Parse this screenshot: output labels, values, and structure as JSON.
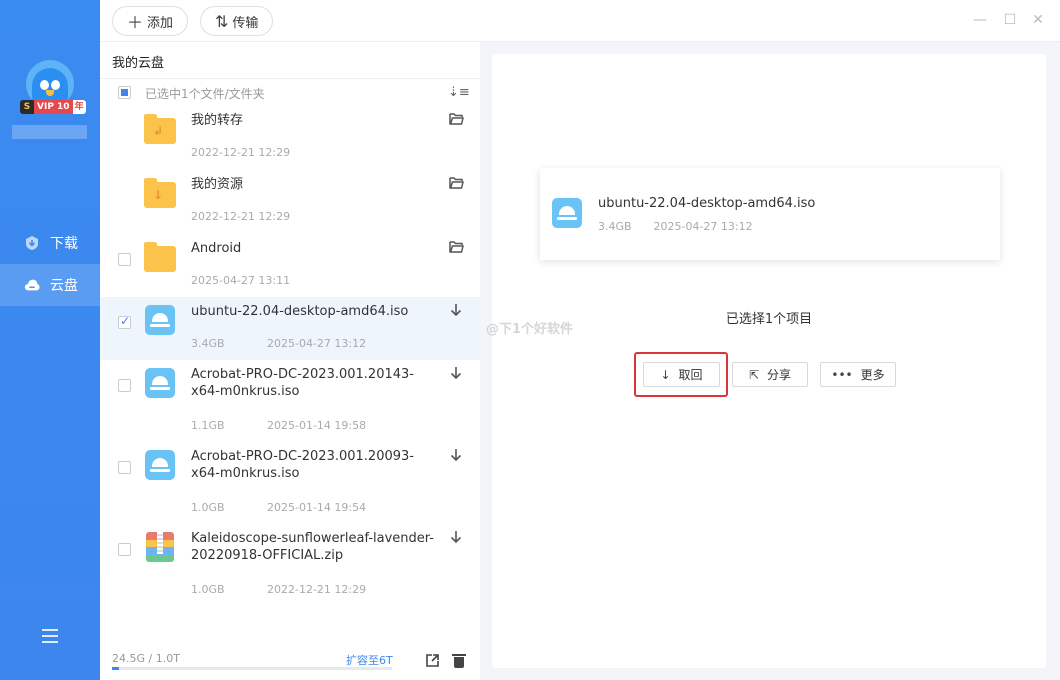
{
  "sidebar": {
    "vip": {
      "s": "S",
      "label": "VIP 10",
      "suffix": "年"
    },
    "nav": [
      {
        "label": "下载",
        "icon": "download-shield-icon"
      },
      {
        "label": "云盘",
        "icon": "cloud-icon",
        "active": true
      }
    ]
  },
  "toolbar": {
    "add_label": "添加",
    "transfer_label": "传输"
  },
  "window": {
    "minimize": "—",
    "maximize": "☐",
    "close": "✕"
  },
  "list": {
    "breadcrumb": "我的云盘",
    "selection_text": "已选中1个文件/文件夹",
    "items": [
      {
        "name": "我的转存",
        "size": "",
        "date": "2022-12-21 12:29",
        "type": "folder",
        "glyph": "↲",
        "action_icon": "open-folder-icon"
      },
      {
        "name": "我的资源",
        "size": "",
        "date": "2022-12-21 12:29",
        "type": "folder",
        "glyph": "↓",
        "action_icon": "open-folder-icon"
      },
      {
        "name": "Android",
        "size": "",
        "date": "2025-04-27 13:11",
        "type": "folder",
        "glyph": "",
        "action_icon": "open-folder-icon"
      },
      {
        "name": "ubuntu-22.04-desktop-amd64.iso",
        "size": "3.4GB",
        "date": "2025-04-27 13:12",
        "type": "iso",
        "selected": true,
        "action_icon": "download-icon"
      },
      {
        "name": "Acrobat-PRO-DC-2023.001.20143-x64-m0nkrus.iso",
        "size": "1.1GB",
        "date": "2025-01-14 19:58",
        "type": "iso",
        "action_icon": "download-icon"
      },
      {
        "name": "Acrobat-PRO-DC-2023.001.20093-x64-m0nkrus.iso",
        "size": "1.0GB",
        "date": "2025-01-14 19:54",
        "type": "iso",
        "action_icon": "download-icon"
      },
      {
        "name": "Kaleidoscope-sunflowerleaf-lavender-20220918-OFFICIAL.zip",
        "size": "1.0GB",
        "date": "2022-12-21 12:29",
        "type": "zip",
        "action_icon": "download-icon"
      }
    ],
    "quota_text": "24.5G / 1.0T",
    "quota_fraction": 0.024,
    "expand_label": "扩容至6T"
  },
  "detail": {
    "file_name": "ubuntu-22.04-desktop-amd64.iso",
    "file_size": "3.4GB",
    "file_date": "2025-04-27 13:12",
    "selected_count": "已选择1个项目",
    "retrieve_label": "取回",
    "share_label": "分享",
    "more_label": "更多"
  },
  "watermark": "@下1个好软件",
  "colors": {
    "accent": "#3d86ee",
    "highlight": "#d9353b",
    "folder": "#fbc34a",
    "iso": "#69c3f5"
  }
}
